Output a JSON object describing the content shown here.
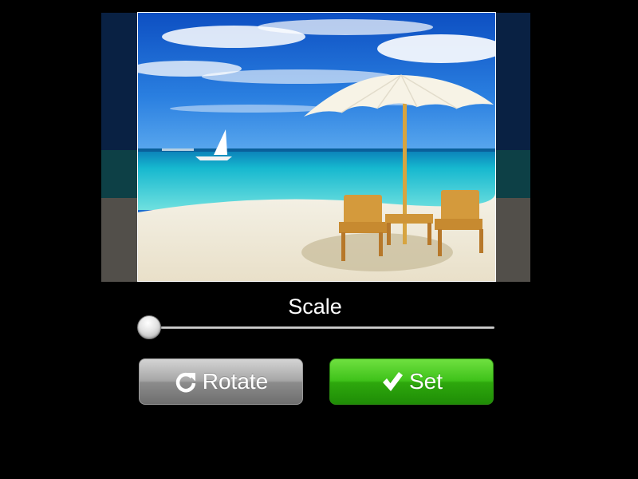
{
  "editor": {
    "photo_name": "beach-photo",
    "scale": {
      "label": "Scale",
      "value": 0
    },
    "buttons": {
      "rotate_label": "Rotate",
      "set_label": "Set"
    },
    "icons": {
      "rotate": "rotate-clockwise-icon",
      "set": "checkmark-icon"
    },
    "colors": {
      "set_button": "#3fc21a",
      "rotate_button": "#a6a6a6",
      "background": "#000000"
    }
  }
}
